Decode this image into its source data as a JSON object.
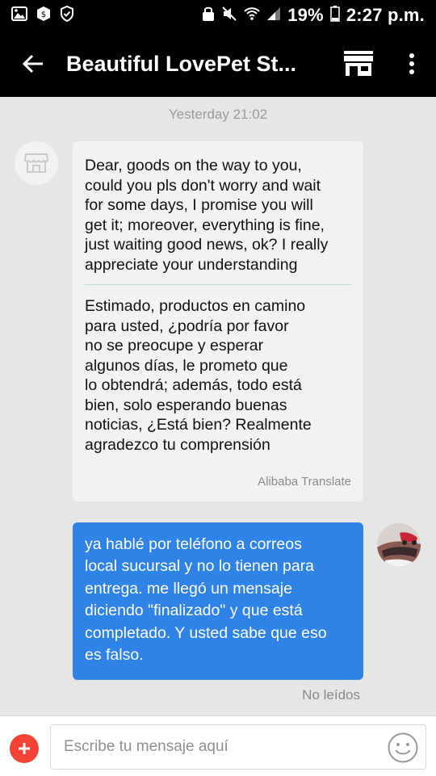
{
  "status_bar": {
    "battery": "19%",
    "time": "2:27 p.m."
  },
  "header": {
    "title": "Beautiful LovePet St...",
    "icons": [
      "back-arrow-icon",
      "store-icon",
      "more-vert-icon"
    ]
  },
  "chat": {
    "timestamp": "Yesterday 21:02",
    "incoming": {
      "original_lines": [
        "Dear, goods on the way to you,",
        "could you pls don't worry and wait",
        "for some days, I promise you will",
        "get it; moreover, everything is fine,",
        "just waiting good news, ok? I really",
        "appreciate your understanding"
      ],
      "translation_lines": [
        "Estimado, productos en camino",
        "para usted, ¿podría por favor",
        "no se preocupe y esperar",
        "algunos días, le prometo que",
        "lo obtendrá; además, todo está",
        "bien, solo esperando buenas",
        "noticias, ¿Está bien? Realmente",
        "agradezco tu comprensión"
      ],
      "translate_credit": "Alibaba Translate"
    },
    "outgoing": {
      "lines": [
        "ya hablé por teléfono a correos",
        "local sucursal y no lo tienen para",
        "entrega. me llegó un mensaje",
        "diciendo \"finalizado\" y que está",
        "completado. Y usted sabe que eso",
        "es falso."
      ],
      "status": "No leídos"
    }
  },
  "composer": {
    "placeholder": "Escribe tu mensaje aquí"
  },
  "colors": {
    "header_bg": "#000000",
    "outgoing_bubble": "#2f82e6",
    "incoming_bubble": "#f2f2f2",
    "add_button": "#f44336"
  }
}
